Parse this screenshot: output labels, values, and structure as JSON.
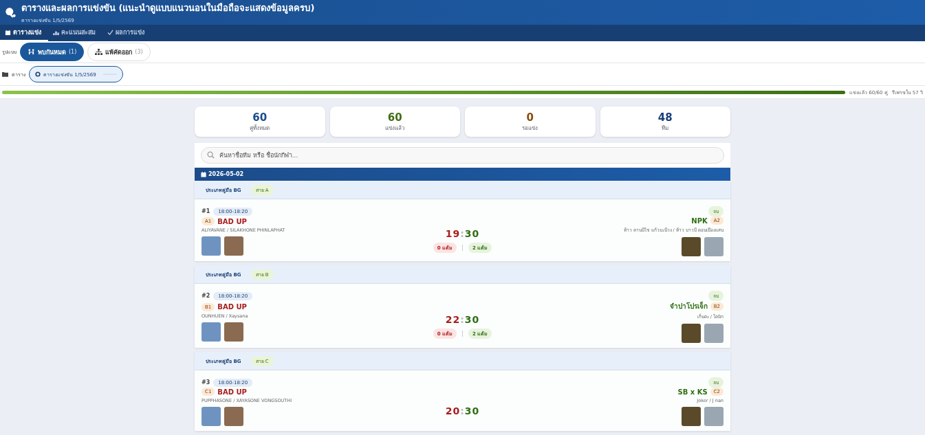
{
  "header": {
    "title": "ตารางและผลการแข่งขัน (แนะนำดูแบบแนวนอนในมือถือจะแสดงข้อมูลครบ)",
    "subtitle": "ตารางแข่งขัน 1/5/2569"
  },
  "tabs": [
    {
      "label": "ตารางแข่ง",
      "selected": true
    },
    {
      "label": "คะแนนสะสม",
      "selected": false
    },
    {
      "label": "ผลการแข่ง",
      "selected": false
    }
  ],
  "format": {
    "label": "รูปแบบ",
    "options": [
      {
        "label": "พบกันหมด",
        "count": "(1)",
        "selected": true
      },
      {
        "label": "แพ้คัดออก",
        "count": "(3)",
        "selected": false
      }
    ]
  },
  "schedule": {
    "label": "ตาราง",
    "options": [
      {
        "label": "ตารางแข่งขัน 1/5/2569",
        "selected": true
      }
    ]
  },
  "progress": {
    "level": 1.0,
    "played": "แข่งแล้ว 60/60 คู่",
    "refresh": "รีเฟรชใน 57 วิ"
  },
  "stats": [
    {
      "value": "60",
      "label": "คู่ทั้งหมด",
      "color": "#1a4b8c"
    },
    {
      "value": "60",
      "label": "แข่งแล้ว",
      "color": "#3f6f14"
    },
    {
      "value": "0",
      "label": "รอแข่ง",
      "color": "#8a4b0c"
    },
    {
      "value": "48",
      "label": "ทีม",
      "color": "#1a3f7a"
    }
  ],
  "search": {
    "placeholder": "ค้นหาชื่อทีม หรือ ชื่อนักกีฬา..."
  },
  "date": "2026-05-02",
  "matches": [
    {
      "category": "ประเภทคู่มือ BG",
      "group": "สาย A",
      "number": "#1",
      "time": "18:00-18:20",
      "status": "จบ",
      "score_separator": ":",
      "left": {
        "seed": "A1",
        "name": "BAD UP",
        "players": "ALIYAVANE / SILAKHONE PHINLAPHAT",
        "score": "19",
        "points": "0 แต้ม",
        "won": false
      },
      "right": {
        "seed": "A2",
        "name": "NPK",
        "players": "ท้าว คานมีไช แก้วมะนีวง / ท้าว บาวมี ดอนเมืองแสน",
        "score": "30",
        "points": "2 แต้ม",
        "won": true
      }
    },
    {
      "category": "ประเภทคู่มือ BG",
      "group": "สาย B",
      "number": "#2",
      "time": "18:00-18:20",
      "status": "จบ",
      "score_separator": ":",
      "left": {
        "seed": "B1",
        "name": "BAD UP",
        "players": "OUNHUEN / Xaysana",
        "score": "22",
        "points": "0 แต้ม",
        "won": false
      },
      "right": {
        "seed": "B2",
        "name": "จำปาโปรเจ็ก",
        "players": "เก็นตะ / โคมิก",
        "score": "30",
        "points": "2 แต้ม",
        "won": true
      }
    },
    {
      "category": "ประเภทคู่มือ BG",
      "group": "สาย C",
      "number": "#3",
      "time": "18:00-18:20",
      "status": "จบ",
      "score_separator": ":",
      "left": {
        "seed": "C1",
        "name": "BAD UP",
        "players": "PUPPHASONE / XAYASONE VONGSOUTHI",
        "score": "20",
        "won": false
      },
      "right": {
        "seed": "C2",
        "name": "SB x KS",
        "players": "Joker / J nan",
        "score": "30",
        "won": true
      }
    }
  ]
}
